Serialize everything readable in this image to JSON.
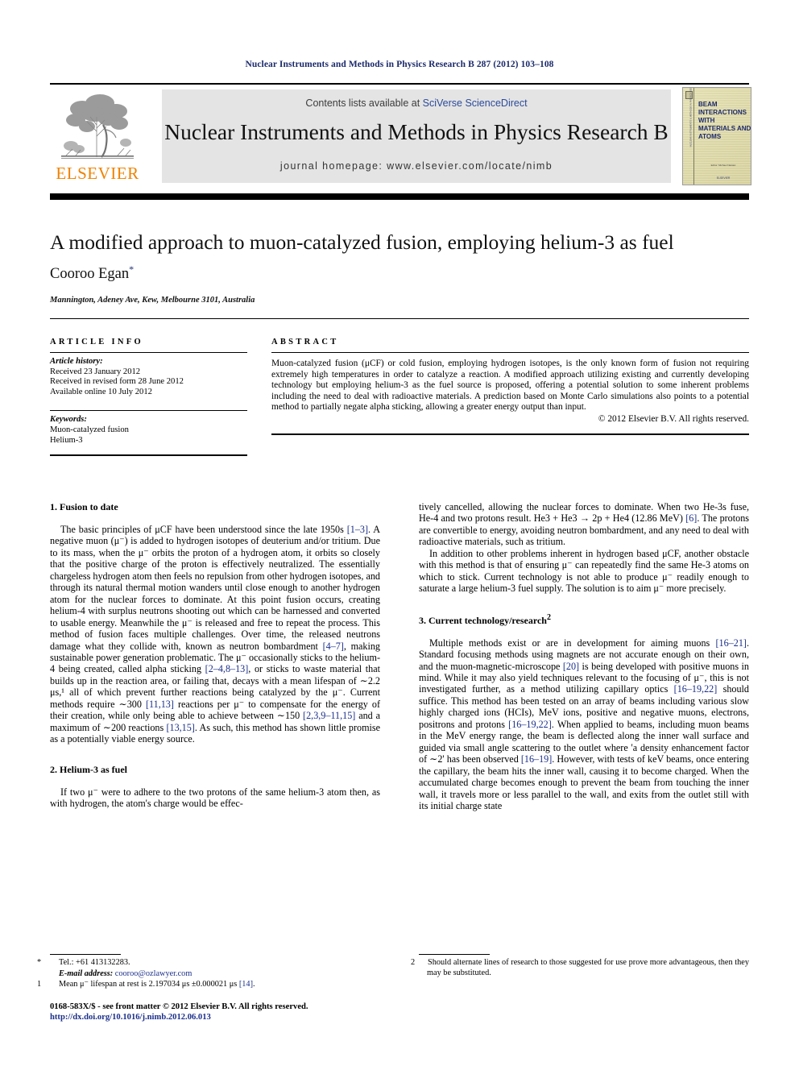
{
  "running_head": "Nuclear Instruments and Methods in Physics Research B 287 (2012) 103–108",
  "masthead": {
    "publisher_name": "ELSEVIER",
    "contents_prefix": "Contents lists available at ",
    "contents_link": "SciVerse ScienceDirect",
    "journal_title": "Nuclear Instruments and Methods in Physics Research B",
    "homepage": "journal homepage: www.elsevier.com/locate/nimb",
    "cover": {
      "title_lines": "BEAM INTERACTIONS WITH MATERIALS AND ATOMS",
      "spine_text": "NUCLEAR INSTRUMENTS & METHODS IN PHYSICS RESEARCH",
      "footer_small": "Editor: Michael Nastasi",
      "footer_publisher": "ELSEVIER"
    }
  },
  "article": {
    "title": "A modified approach to muon-catalyzed fusion, employing helium-3 as fuel",
    "author": "Cooroo Egan",
    "author_mark": "*",
    "affiliation": "Mannington, Adeney Ave, Kew, Melbourne 3101, Australia"
  },
  "article_info": {
    "heading": "ARTICLE INFO",
    "history_label": "Article history:",
    "history": [
      "Received 23 January 2012",
      "Received in revised form 28 June 2012",
      "Available online 10 July 2012"
    ],
    "keywords_label": "Keywords:",
    "keywords": [
      "Muon-catalyzed fusion",
      "Helium-3"
    ]
  },
  "abstract": {
    "heading": "ABSTRACT",
    "text": "Muon-catalyzed fusion (μCF) or cold fusion, employing hydrogen isotopes, is the only known form of fusion not requiring extremely high temperatures in order to catalyze a reaction. A modified approach utilizing existing and currently developing technology but employing helium-3 as the fuel source is proposed, offering a potential solution to some inherent problems including the need to deal with radioactive materials. A prediction based on Monte Carlo simulations also points to a potential method to partially negate alpha sticking, allowing a greater energy output than input.",
    "copyright": "© 2012 Elsevier B.V. All rights reserved."
  },
  "sections": {
    "s1_heading": "1. Fusion to date",
    "s1_p1_a": "The basic principles of μCF have been understood since the late 1950s ",
    "s1_p1_r1": "[1–3]",
    "s1_p1_b": ". A negative muon (μ⁻) is added to hydrogen isotopes of deuterium and/or tritium. Due to its mass, when the μ⁻ orbits the proton of a hydrogen atom, it orbits so closely that the positive charge of the proton is effectively neutralized. The essentially chargeless hydrogen atom then feels no repulsion from other hydrogen isotopes, and through its natural thermal motion wanders until close enough to another hydrogen atom for the nuclear forces to dominate. At this point fusion occurs, creating helium-4 with surplus neutrons shooting out which can be harnessed and converted to usable energy. Meanwhile the μ⁻ is released and free to repeat the process. This method of fusion faces multiple challenges. Over time, the released neutrons damage what they collide with, known as neutron bombardment ",
    "s1_p1_r2": "[4–7]",
    "s1_p1_c": ", making sustainable power generation problematic. The μ⁻ occasionally sticks to the helium-4 being created, called alpha sticking ",
    "s1_p1_r3": "[2–4,8–13]",
    "s1_p1_d": ", or sticks to waste material that builds up in the reaction area, or failing that, decays with a mean lifespan of ∼2.2 μs,¹ all of which prevent further reactions being catalyzed by the μ⁻. Current methods require ∼300 ",
    "s1_p1_r4": "[11,13]",
    "s1_p1_e": " reactions per μ⁻ to compensate for the energy of their creation, while only being able to achieve between ∼150 ",
    "s1_p1_r5": "[2,3,9–11,15]",
    "s1_p1_f": " and a maximum of ∼200 reactions ",
    "s1_p1_r6": "[13,15]",
    "s1_p1_g": ". As such, this method has shown little promise as a potentially viable energy source.",
    "s2_heading": "2. Helium-3 as fuel",
    "s2_p1": "If two μ⁻ were to adhere to the two protons of the same helium-3 atom then, as with hydrogen, the atom's charge would be effec-",
    "s3_cont_a": "tively cancelled, allowing the nuclear forces to dominate. When two He-3s fuse, He-4 and two protons result. He3 + He3 → 2p + He4 (12.86 MeV) ",
    "s3_cont_r1": "[6]",
    "s3_cont_b": ". The protons are convertible to energy, avoiding neutron bombardment, and any need to deal with radioactive materials, such as tritium.",
    "s3_cont_p2": "In addition to other problems inherent in hydrogen based μCF, another obstacle with this method is that of ensuring μ⁻ can repeatedly find the same He-3 atoms on which to stick. Current technology is not able to produce μ⁻ readily enough to saturate a large helium-3 fuel supply. The solution is to aim μ⁻ more precisely.",
    "s3_heading": "3. Current technology/research",
    "s3_heading_sup": "2",
    "s3_p1_a": "Multiple methods exist or are in development for aiming muons ",
    "s3_p1_r1": "[16–21]",
    "s3_p1_b": ". Standard focusing methods using magnets are not accurate enough on their own, and the muon-magnetic-microscope ",
    "s3_p1_r2": "[20]",
    "s3_p1_c": " is being developed with positive muons in mind. While it may also yield techniques relevant to the focusing of μ⁻, this is not investigated further, as a method utilizing capillary optics ",
    "s3_p1_r3": "[16–19,22]",
    "s3_p1_d": " should suffice. This method has been tested on an array of beams including various slow highly charged ions (HCIs), MeV ions, positive and negative muons, electrons, positrons and protons ",
    "s3_p1_r4": "[16–19,22]",
    "s3_p1_e": ". When applied to beams, including muon beams in the MeV energy range, the beam is deflected along the inner wall surface and guided via small angle scattering to the outlet where 'a density enhancement factor of ∼2' has been observed ",
    "s3_p1_r5": "[16–19]",
    "s3_p1_f": ". However, with tests of keV beams, once entering the capillary, the beam hits the inner wall, causing it to become charged. When the accumulated charge becomes enough to prevent the beam from touching the inner wall, it travels more or less parallel to the wall, and exits from the outlet still with its initial charge state"
  },
  "footnotes": {
    "star_mark": "*",
    "star_text": "Tel.: +61 413132283.",
    "email_label": "E-mail address:",
    "email": "cooroo@ozlawyer.com",
    "fn1_mark": "1",
    "fn1_a": "Mean μ⁻ lifespan at rest is 2.197034 μs ±0.000021 μs ",
    "fn1_ref": "[14]",
    "fn1_b": ".",
    "fn2_mark": "2",
    "fn2_text": "Should alternate lines of research to those suggested for use prove more advantageous, then they may be substituted."
  },
  "imprint": {
    "line1": "0168-583X/$ - see front matter © 2012 Elsevier B.V. All rights reserved.",
    "doi": "http://dx.doi.org/10.1016/j.nimb.2012.06.013"
  },
  "colors": {
    "elsevier_orange": "#ef8200",
    "link_blue": "#1b2f8a",
    "runhead_navy": "#1b2a6b",
    "banner_gray": "#e4e4e4"
  }
}
